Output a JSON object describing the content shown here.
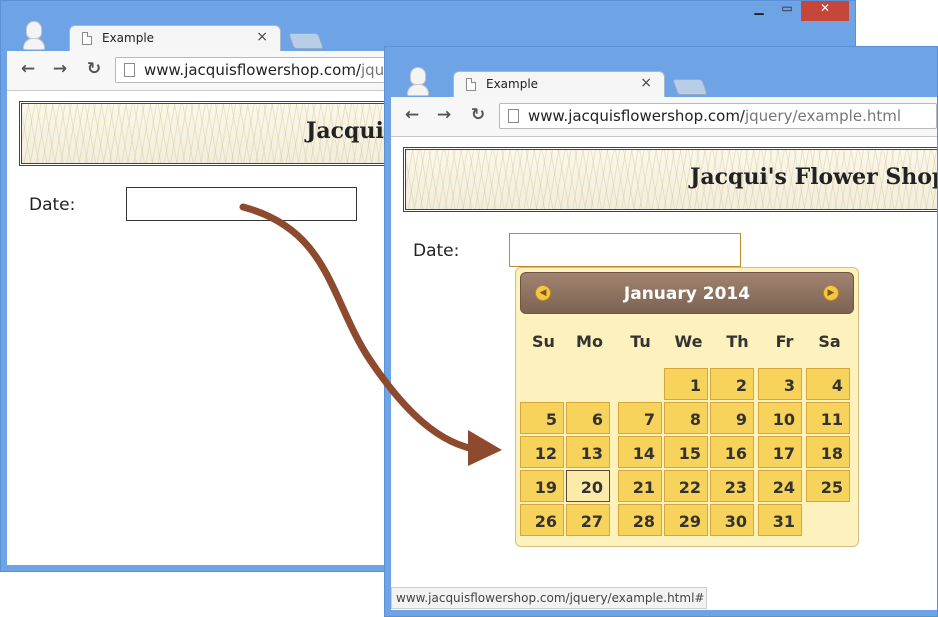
{
  "back_window": {
    "tab_title": "Example",
    "tab_close": "×",
    "window_controls": {
      "minimize": "▁",
      "maximize": "▭",
      "close": "✕"
    },
    "url_main": "www.jacquisflowershop.com/",
    "url_rest": "jque",
    "banner_title": "Jacqui",
    "date_label": "Date:",
    "date_value": ""
  },
  "front_window": {
    "tab_title": "Example",
    "tab_close": "×",
    "url_main": "www.jacquisflowershop.com/",
    "url_rest": "jquery/example.html",
    "banner_title": "Jacqui's Flower Shop",
    "date_label": "Date:",
    "date_value": "",
    "status_text": "www.jacquisflowershop.com/jquery/example.html#"
  },
  "nav": {
    "back_icon": "←",
    "forward_icon": "→",
    "reload_icon": "↻"
  },
  "datepicker": {
    "month_title": "January 2014",
    "prev_icon": "◀",
    "next_icon": "▶",
    "weekdays": [
      "Su",
      "Mo",
      "Tu",
      "We",
      "Th",
      "Fr",
      "Sa"
    ],
    "first_weekday_index": 3,
    "days_in_month": 31,
    "today": 20,
    "days": [
      "1",
      "2",
      "3",
      "4",
      "5",
      "6",
      "7",
      "8",
      "9",
      "10",
      "11",
      "12",
      "13",
      "14",
      "15",
      "16",
      "17",
      "18",
      "19",
      "20",
      "21",
      "22",
      "23",
      "24",
      "25",
      "26",
      "27",
      "28",
      "29",
      "30",
      "31"
    ]
  },
  "colors": {
    "window_frame": "#6ea3e6",
    "close_button": "#c7463c",
    "calendar_bg": "#fdf2bd",
    "day_cell": "#f7d35b",
    "header_brown": "#8a6e5c",
    "arrow": "#8e4a2e"
  }
}
